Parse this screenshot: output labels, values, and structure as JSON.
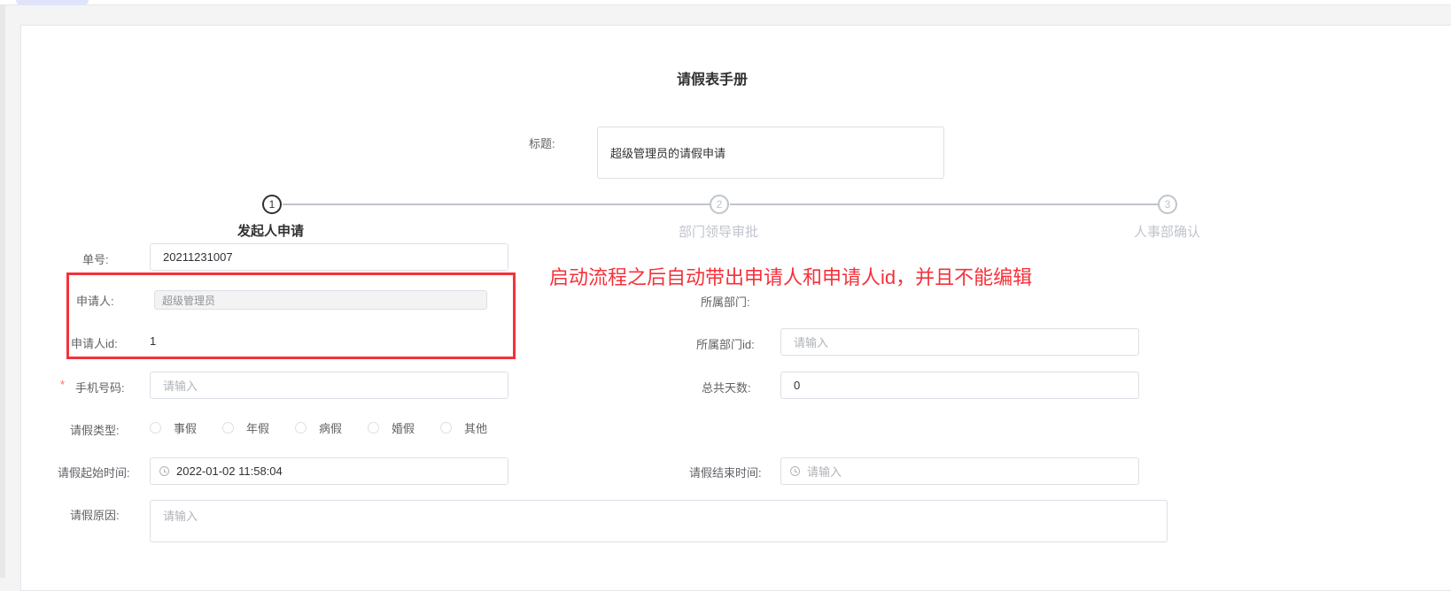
{
  "form_title": "请假表手册",
  "subject": {
    "label": "标题:",
    "value": "超级管理员的请假申请"
  },
  "steps": [
    {
      "num": "1",
      "label": "发起人申请"
    },
    {
      "num": "2",
      "label": "部门领导审批"
    },
    {
      "num": "3",
      "label": "人事部确认"
    }
  ],
  "fields": {
    "order_no": {
      "label": "单号:",
      "value": "20211231007"
    },
    "applicant": {
      "label": "申请人:",
      "value": "超级管理员"
    },
    "applicant_id": {
      "label": "申请人id:",
      "value": "1"
    },
    "department": {
      "label": "所属部门:"
    },
    "department_id": {
      "label": "所属部门id:",
      "placeholder": "请输入"
    },
    "phone": {
      "required_mark": "*",
      "label": "手机号码:",
      "placeholder": "请输入"
    },
    "total_days": {
      "label": "总共天数:",
      "value": "0"
    },
    "leave_type": {
      "label": "请假类型:",
      "options": [
        "事假",
        "年假",
        "病假",
        "婚假",
        "其他"
      ]
    },
    "start_time": {
      "label": "请假起始时间:",
      "value": "2022-01-02 11:58:04"
    },
    "end_time": {
      "label": "请假结束时间:",
      "placeholder": "请输入"
    },
    "reason": {
      "label": "请假原因:",
      "placeholder": "请输入"
    }
  },
  "annotation": {
    "text": "启动流程之后自动带出申请人和申请人id，并且不能编辑",
    "color": "#f5222d"
  }
}
